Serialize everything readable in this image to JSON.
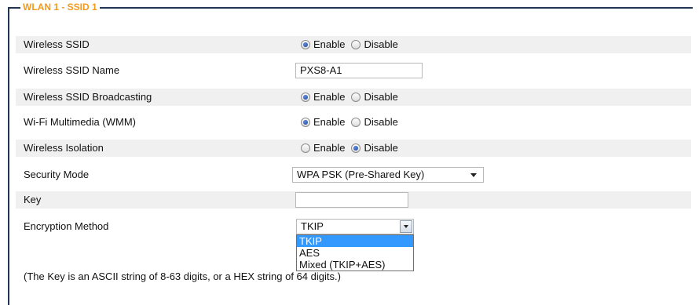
{
  "section": {
    "title": "WLAN 1 - SSID 1"
  },
  "rows": {
    "ssid": {
      "label": "Wireless SSID",
      "opt_enable": "Enable",
      "opt_disable": "Disable",
      "selected": "Enable"
    },
    "ssid_name": {
      "label": "Wireless SSID Name",
      "value": "PXS8-A1"
    },
    "broadcast": {
      "label": "Wireless SSID Broadcasting",
      "opt_enable": "Enable",
      "opt_disable": "Disable",
      "selected": "Enable"
    },
    "wmm": {
      "label": "Wi-Fi Multimedia (WMM)",
      "opt_enable": "Enable",
      "opt_disable": "Disable",
      "selected": "Enable"
    },
    "isolation": {
      "label": "Wireless Isolation",
      "opt_enable": "Enable",
      "opt_disable": "Disable",
      "selected": "Disable"
    },
    "security": {
      "label": "Security Mode",
      "value": "WPA PSK (Pre-Shared Key)"
    },
    "key": {
      "label": "Key",
      "value": ""
    },
    "encryption": {
      "label": "Encryption Method",
      "value": "TKIP",
      "options": [
        "TKIP",
        "AES",
        "Mixed (TKIP+AES)"
      ],
      "highlighted": "TKIP"
    }
  },
  "note": "(The Key is an ASCII string of 8-63 digits, or a HEX string of 64 digits.)",
  "colors": {
    "legend": "#f39a1b",
    "border": "#1f3552",
    "row_shade": "#f0f0f0",
    "highlight": "#3399ff"
  }
}
